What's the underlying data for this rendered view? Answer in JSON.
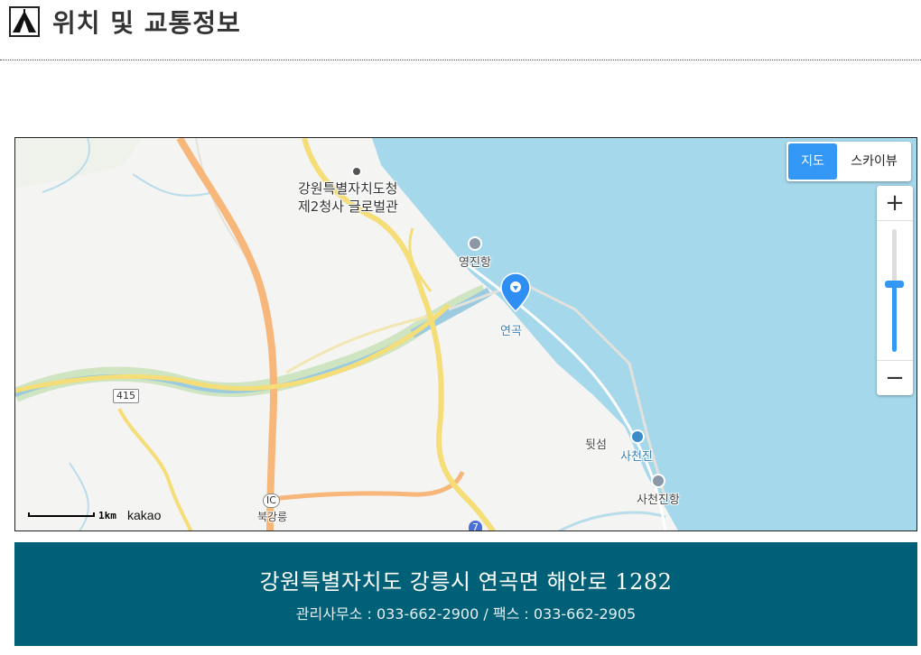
{
  "header": {
    "title": "위치 및 교통정보",
    "logo_icon": "tent-icon"
  },
  "map": {
    "type_control": {
      "map_label": "지도",
      "skyview_label": "스카이뷰",
      "active": "지도"
    },
    "zoom": {
      "in_label": "+",
      "out_label": "−",
      "level_fraction": 0.55
    },
    "labels": {
      "gov_office_line1": "강원특별자치도청",
      "gov_office_line2": "제2청사 글로벌관",
      "yeongjin_port": "영진항",
      "yeongok": "연곡",
      "twitseom": "뒷섬",
      "sacheonjin": "사천진",
      "sacheonjin_port": "사천진항",
      "bukgangneung": "북강릉",
      "ic_badge": "IC",
      "route_415": "415",
      "route_7": "7"
    },
    "scale": {
      "distance": "1km"
    },
    "attribution": "kakao",
    "colors": {
      "sea": "#a6d8ec",
      "land": "#f4f4f2",
      "highway": "#f7b77a",
      "road": "#f5dd78",
      "river": "#cfe4c0",
      "accent": "#3397f6"
    }
  },
  "info": {
    "address": "강원특별자치도 강릉시 연곡면 해안로 1282",
    "contact": "관리사무소 : 033-662-2900 / 팩스 : 033-662-2905"
  }
}
